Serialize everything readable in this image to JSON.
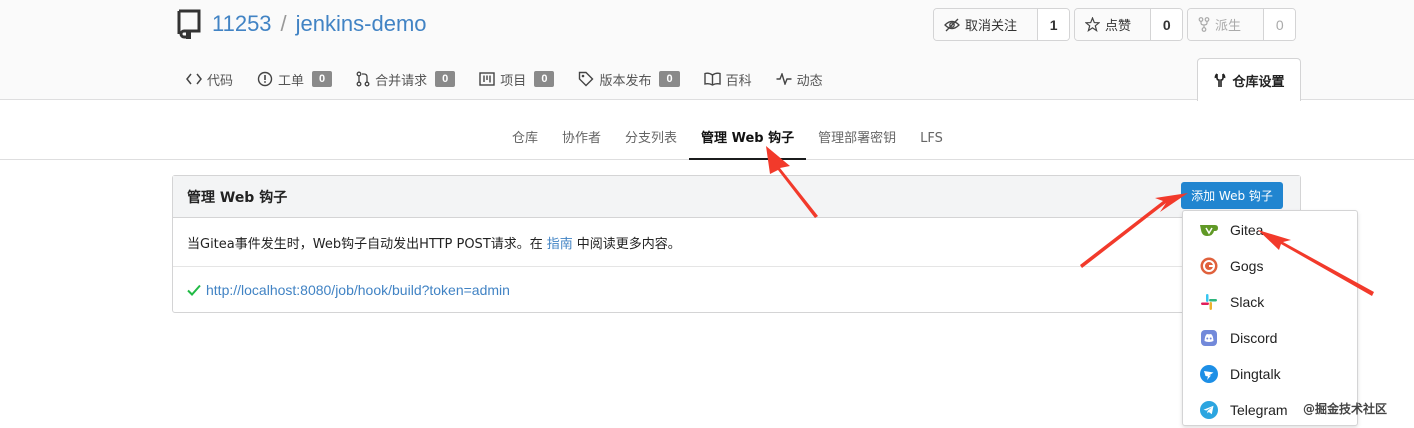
{
  "repo": {
    "owner": "11253",
    "separator": "/",
    "name": "jenkins-demo"
  },
  "actions": {
    "watch": {
      "label": "取消关注",
      "count": "1"
    },
    "star": {
      "label": "点赞",
      "count": "0"
    },
    "fork": {
      "label": "派生",
      "count": "0"
    }
  },
  "tabs": [
    {
      "label": "代码",
      "icon": "code-icon"
    },
    {
      "label": "工单",
      "badge": "0",
      "icon": "issue-icon"
    },
    {
      "label": "合并请求",
      "badge": "0",
      "icon": "pull-request-icon"
    },
    {
      "label": "项目",
      "badge": "0",
      "icon": "project-icon"
    },
    {
      "label": "版本发布",
      "badge": "0",
      "icon": "tag-icon"
    },
    {
      "label": "百科",
      "icon": "book-icon"
    },
    {
      "label": "动态",
      "icon": "pulse-icon"
    }
  ],
  "settings_tab": {
    "label": "仓库设置",
    "icon": "tools-icon"
  },
  "sub_nav": [
    "仓库",
    "协作者",
    "分支列表",
    "管理 Web 钩子",
    "管理部署密钥",
    "LFS"
  ],
  "sub_nav_active": "管理 Web 钩子",
  "panel": {
    "title": "管理 Web 钩子",
    "add_button": "添加 Web 钩子",
    "desc_before": "当Gitea事件发生时，Web钩子自动发出HTTP POST请求。在",
    "desc_link": "指南",
    "desc_after": "中阅读更多内容。",
    "hook_url": "http://localhost:8080/job/hook/build?token=admin",
    "hook_status_icon": "check-icon",
    "hook_status_color": "#21ba45"
  },
  "dropdown": [
    {
      "label": "Gitea",
      "icon": "gitea-icon",
      "color": "#609926"
    },
    {
      "label": "Gogs",
      "icon": "gogs-icon",
      "color": "#e0613c"
    },
    {
      "label": "Slack",
      "icon": "slack-icon",
      "color": "#4a154b"
    },
    {
      "label": "Discord",
      "icon": "discord-icon",
      "color": "#7289da"
    },
    {
      "label": "Dingtalk",
      "icon": "dingtalk-icon",
      "color": "#1d8fe6"
    },
    {
      "label": "Telegram",
      "icon": "telegram-icon",
      "color": "#2ca5e0"
    }
  ],
  "annotation_color": "#f23a2b",
  "watermark": "@掘金技术社区"
}
